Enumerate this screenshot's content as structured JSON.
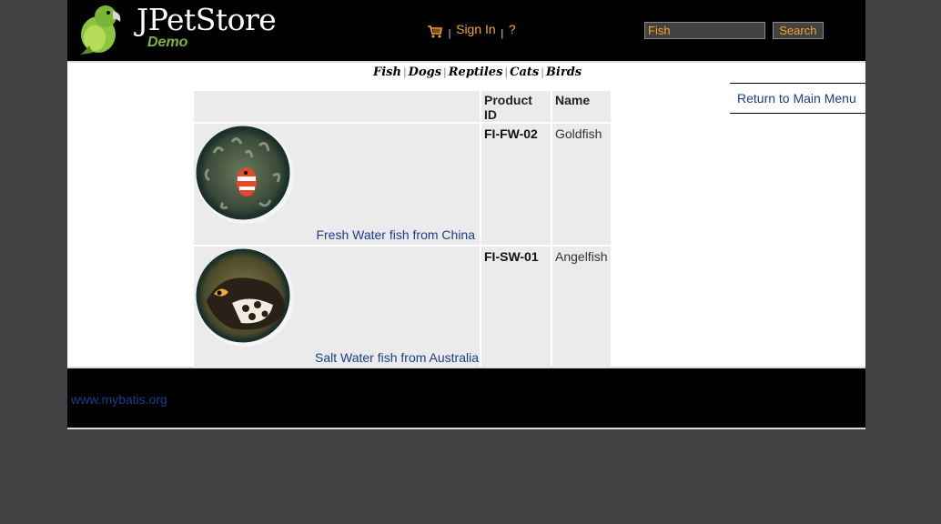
{
  "header": {
    "logo_title": "JPetStore",
    "logo_subtitle": "Demo",
    "menu": {
      "sign_in": "Sign In",
      "help": "?",
      "separator": "|"
    },
    "search": {
      "value": "Fish",
      "button": "Search"
    }
  },
  "quicklinks": [
    "Fish",
    "Dogs",
    "Reptiles",
    "Cats",
    "Birds"
  ],
  "quicklink_separator": "|",
  "sidebar": {
    "return_link": "Return to Main Menu"
  },
  "table": {
    "columns": [
      "",
      "Product ID",
      "Name"
    ],
    "rows": [
      {
        "description": "Fresh Water fish from China",
        "product_id": "FI-FW-02",
        "name": "Goldfish"
      },
      {
        "description": "Salt Water fish from Australia",
        "product_id": "FI-SW-01",
        "name": "Angelfish"
      }
    ]
  },
  "footer": {
    "link": "www.mybatis.org"
  },
  "colors": {
    "page_bg": "#424242",
    "header_bg": "#000000",
    "accent": "#f5a623",
    "link": "#1a3c8e",
    "cell_bg": "#ebebeb"
  },
  "icons": [
    "parrot-logo-icon",
    "cart-icon",
    "clownfish-image",
    "triggerfish-image"
  ]
}
